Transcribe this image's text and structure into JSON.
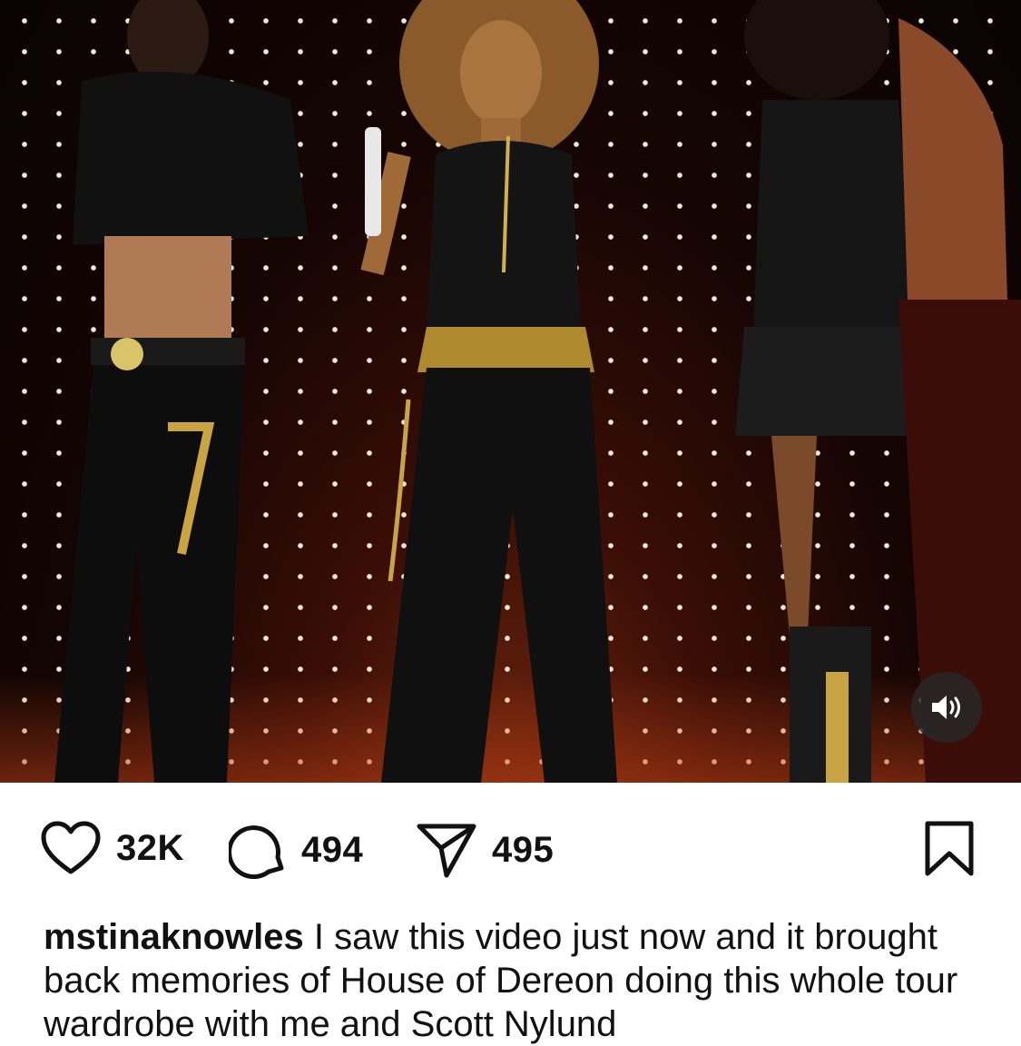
{
  "post": {
    "video": {
      "mute_icon": "speaker-volume-icon",
      "scene": "stage-performance"
    },
    "actions": {
      "like": {
        "icon": "heart-icon",
        "count": "32K"
      },
      "comment": {
        "icon": "comment-bubble-icon",
        "count": "494"
      },
      "share": {
        "icon": "paper-plane-icon",
        "count": "495"
      },
      "save": {
        "icon": "bookmark-icon"
      }
    },
    "caption": {
      "username": "mstinaknowles",
      "text": "I saw this video just now and it brought back memories of House of Dereon  doing this whole tour wardrobe with me and Scott Nylund"
    }
  }
}
